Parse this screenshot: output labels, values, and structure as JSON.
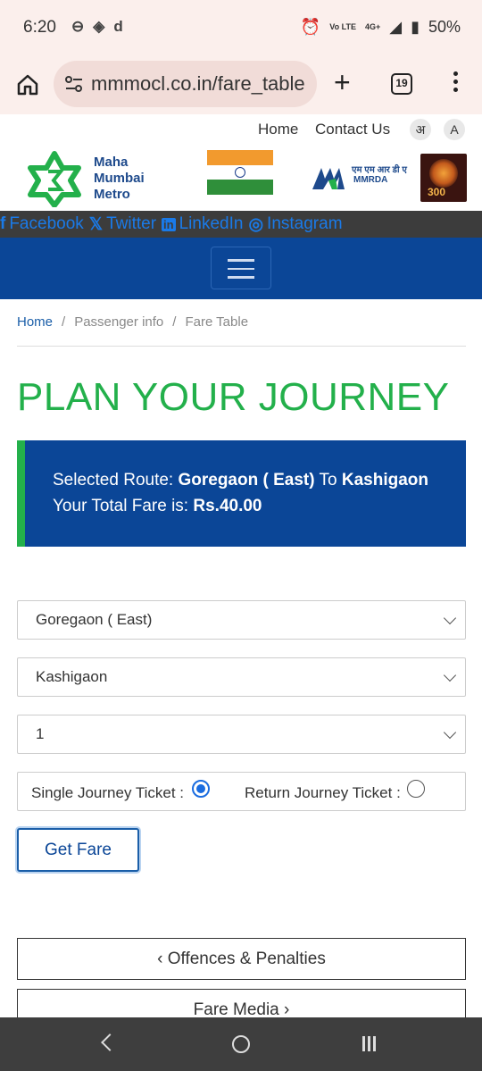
{
  "status_bar": {
    "time": "6:20",
    "battery": "50%",
    "network": "4G+",
    "volte": "Vo LTE"
  },
  "browser": {
    "url": "mmmocl.co.in/fare_table",
    "tab_count": "19"
  },
  "header": {
    "links": [
      "Home",
      "Contact Us"
    ],
    "lang_hindi": "अ",
    "lang_english": "A",
    "logo_lines": [
      "Maha",
      "Mumbai",
      "Metro"
    ],
    "mmrda_hindi": "एम एम आर डी ए",
    "mmrda_label": "MMRDA",
    "event_badge_text": "300"
  },
  "social": [
    {
      "icon": "f",
      "label": "Facebook"
    },
    {
      "icon": "𝕏",
      "label": "Twitter"
    },
    {
      "icon": "in",
      "label": "LinkedIn"
    },
    {
      "icon": "◎",
      "label": "Instagram"
    }
  ],
  "breadcrumb": {
    "home": "Home",
    "items": [
      "Passenger info",
      "Fare Table"
    ],
    "separator": "/"
  },
  "page": {
    "title": "PLAN YOUR JOURNEY"
  },
  "result": {
    "route_label": "Selected Route:",
    "from": "Goregaon ( East)",
    "to_word": "To",
    "to": "Kashigaon",
    "fare_label": "Your Total Fare is:",
    "fare_value": "Rs.40.00"
  },
  "form": {
    "from_station": "Goregaon ( East)",
    "to_station": "Kashigaon",
    "passengers": "1",
    "single_label": "Single Journey Ticket :",
    "return_label": "Return Journey Ticket :",
    "single_checked": true,
    "return_checked": false,
    "submit_label": "Get Fare"
  },
  "bottom_links": {
    "offences": "Offences & Penalties",
    "fare_media": "Fare Media"
  },
  "colors": {
    "primary_blue": "#0b4697",
    "accent_green": "#23b04b",
    "link_blue": "#1a7ae8"
  }
}
